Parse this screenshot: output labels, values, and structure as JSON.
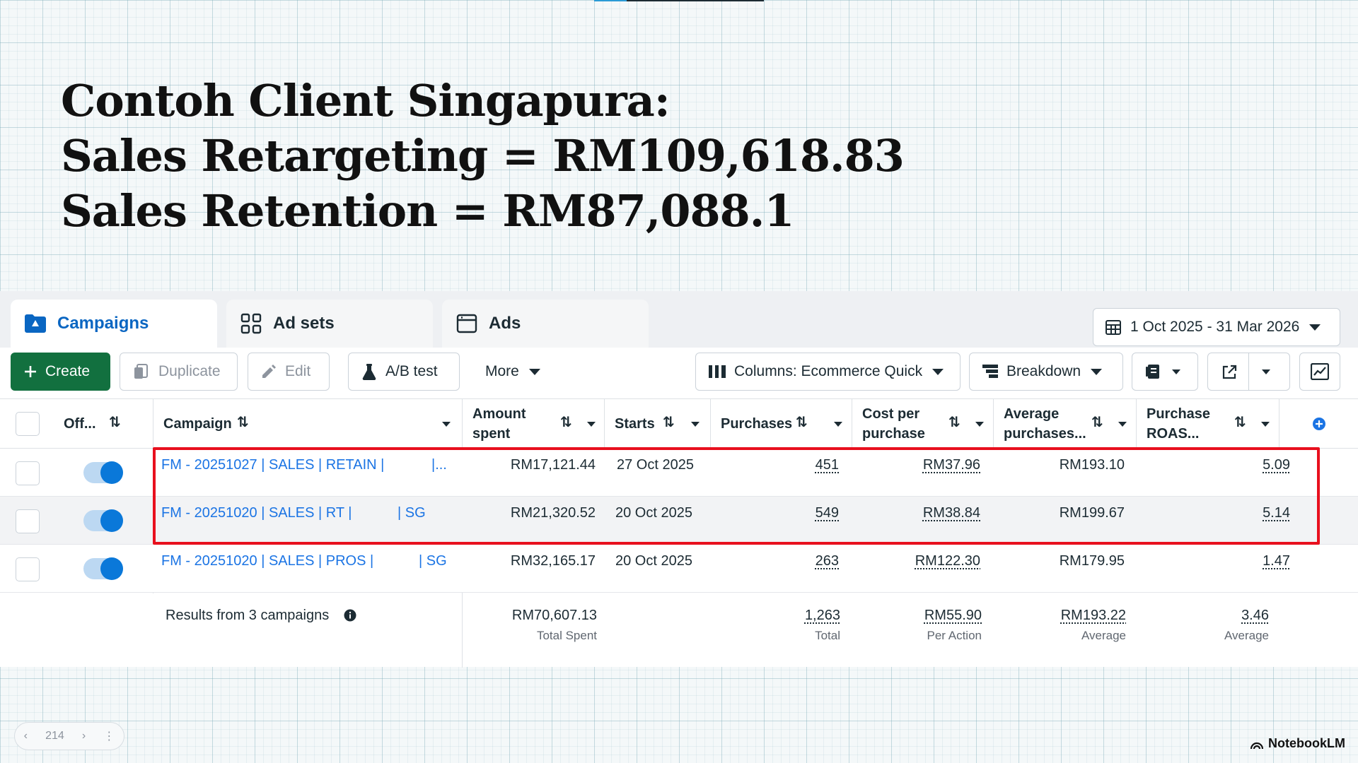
{
  "slide": {
    "title_lines": [
      "Contoh Client Singapura:",
      "Sales Retargeting = RM109,618.83",
      "Sales Retention = RM87,088.1"
    ]
  },
  "tabs": [
    {
      "label": "Campaigns",
      "active": true,
      "icon": "folder-icon"
    },
    {
      "label": "Ad sets",
      "active": false,
      "icon": "grid-icon"
    },
    {
      "label": "Ads",
      "active": false,
      "icon": "ad-frame-icon"
    }
  ],
  "date_range": "1 Oct 2025 - 31 Mar 2026",
  "toolbar": {
    "create": "Create",
    "duplicate": "Duplicate",
    "edit": "Edit",
    "ab_test": "A/B test",
    "more": "More",
    "columns": "Columns: Ecommerce Quick",
    "breakdown": "Breakdown"
  },
  "columns": {
    "off": "Off...",
    "campaign": "Campaign",
    "amount_spent": [
      "Amount",
      "spent"
    ],
    "starts": "Starts",
    "purchases": "Purchases",
    "cost_per_purchase": [
      "Cost per",
      "purchase"
    ],
    "average_purchases": [
      "Average",
      "purchases..."
    ],
    "purchase_roas": [
      "Purchase",
      "ROAS..."
    ],
    "sort_glyph": "⇅"
  },
  "rows": [
    {
      "name_a": "FM - 20251027 | SALES | RETAIN |",
      "name_b": "|...",
      "amount": "RM17,121.44",
      "starts": "27 Oct 2025",
      "purchases": "451",
      "cpp": "RM37.96",
      "avg": "RM193.10",
      "roas": "5.09",
      "on": true
    },
    {
      "name_a": "FM - 20251020 | SALES | RT |",
      "name_b": "| SG",
      "amount": "RM21,320.52",
      "starts": "20 Oct 2025",
      "purchases": "549",
      "cpp": "RM38.84",
      "avg": "RM199.67",
      "roas": "5.14",
      "on": true
    },
    {
      "name_a": "FM - 20251020 | SALES | PROS |",
      "name_b": "| SG",
      "amount": "RM32,165.17",
      "starts": "20 Oct 2025",
      "purchases": "263",
      "cpp": "RM122.30",
      "avg": "RM179.95",
      "roas": "1.47",
      "on": true
    }
  ],
  "summary": {
    "label": "Results from 3 campaigns",
    "amount": "RM70,607.13",
    "amount_sub": "Total Spent",
    "purchases": "1,263",
    "purchases_sub": "Total",
    "cpp": "RM55.90",
    "cpp_sub": "Per Action",
    "avg": "RM193.22",
    "avg_sub": "Average",
    "roas": "3.46",
    "roas_sub": "Average"
  },
  "pager": {
    "page": "214"
  },
  "brand": "NotebookLM",
  "colors": {
    "accent_blue": "#1b74e4",
    "create_green": "#12703f",
    "highlight_red": "#e8101e"
  }
}
